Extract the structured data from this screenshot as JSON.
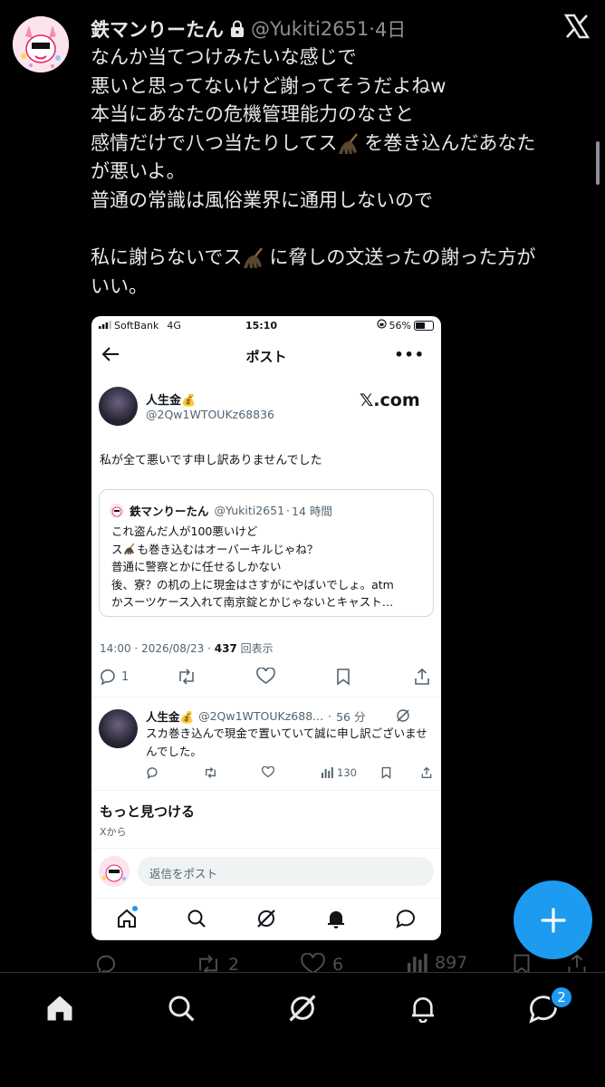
{
  "tweet": {
    "author_name": "鉄マンりーたん",
    "handle": "@Yukiti2651",
    "separator": "·",
    "time": "4日",
    "lines": [
      {
        "parts": [
          "なんか当てつけみたいな感じで"
        ]
      },
      {
        "parts": [
          "悪いと思ってないけど謝ってそうだよねw"
        ]
      },
      {
        "parts": [
          "本当にあなたの危機管理能力のなさと"
        ]
      },
      {
        "parts": [
          "感情だけで八つ当たりしてス",
          "を巻き込んだあなた"
        ]
      },
      {
        "parts": [
          "が悪いよ。"
        ]
      },
      {
        "parts": [
          "普通の常識は風俗業界に通用しないので"
        ]
      },
      {
        "parts": [
          ""
        ]
      },
      {
        "parts": [
          "私に謝らないでス",
          "に脅しの文送ったの謝った方が"
        ]
      },
      {
        "parts": [
          "いい。"
        ]
      }
    ],
    "actions": {
      "replies": "",
      "retweets": "2",
      "likes": "6",
      "views": "897"
    }
  },
  "embedded": {
    "status": {
      "carrier": "SoftBank",
      "network": "4G",
      "time": "15:10",
      "battery": "56%",
      "battery_level": 0.56
    },
    "nav_title": "ポスト",
    "quoted_author": {
      "name": "人生金💰",
      "handle": "@2Qw1WTOUKz68836",
      "logo_text": "𝕏.com"
    },
    "post_text": "私が全て悪いです申し訳ありませんでした",
    "quoted_card": {
      "name": "鉄マンりーたん",
      "handle": "@Yukiti2651",
      "time": "14 時間",
      "lines": [
        [
          "これ盗んだ人が100悪いけど"
        ],
        [
          "ス",
          "も巻き込むはオーバーキルじゃね？"
        ],
        [
          "普通に警察とかに任せるしかない"
        ],
        [
          "後、寮？の机の上に現金はさすがにやばいでしょ。atm"
        ],
        [
          "かスーツケース入れて南京錠とかじゃないとキャスト…"
        ]
      ]
    },
    "meta": {
      "time": "14:00",
      "date": "2026/08/23",
      "views": "437",
      "views_label": "回表示"
    },
    "actions": {
      "replies": "1"
    },
    "reply": {
      "name": "人生金💰",
      "handle": "@2Qw1WTOUKz688...",
      "time": "56 分",
      "text": "スカ巻き込んで現金で置いていて誠に申し訳ございませんでした。",
      "views": "130"
    },
    "discover_title": "もっと見つける",
    "discover_sub": "Xから",
    "reply_placeholder": "返信をポスト"
  },
  "notifications_badge": "2",
  "colors": {
    "accent": "#1d9bf0",
    "background": "#000000",
    "text": "#e7e9ea",
    "muted": "#8b9095"
  }
}
